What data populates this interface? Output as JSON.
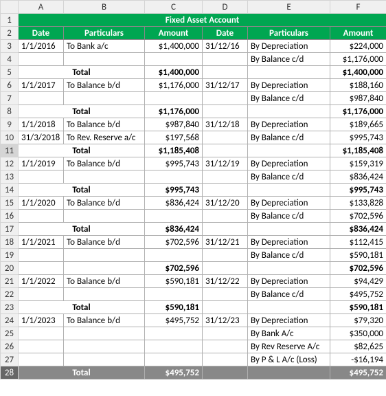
{
  "columns": [
    "A",
    "B",
    "C",
    "D",
    "E",
    "F"
  ],
  "title": "Fixed Asset Account",
  "headers": {
    "date1": "Date",
    "part1": "Particulars",
    "amt1": "Amount",
    "date2": "Date",
    "part2": "Particulars",
    "amt2": "Amount"
  },
  "r3": {
    "a": "1/1/2016",
    "b": "To Bank a/c",
    "c": "$1,400,000",
    "d": "31/12/16",
    "e": "By Depreciation",
    "f": "$224,000"
  },
  "r4": {
    "a": "",
    "b": "",
    "c": "",
    "d": "",
    "e": "By Balance c/d",
    "f": "$1,176,000"
  },
  "r5": {
    "tot": "Total",
    "c": "$1,400,000",
    "d": "",
    "e": "",
    "f": "$1,400,000"
  },
  "r6": {
    "a": "1/1/2017",
    "b": "To Balance b/d",
    "c": "$1,176,000",
    "d": "31/12/17",
    "e": "By Depreciation",
    "f": "$188,160"
  },
  "r7": {
    "a": "",
    "b": "",
    "c": "",
    "d": "",
    "e": "By Balance c/d",
    "f": "$987,840"
  },
  "r8": {
    "tot": "Total",
    "c": "$1,176,000",
    "d": "",
    "e": "",
    "f": "$1,176,000"
  },
  "r9": {
    "a": "1/1/2018",
    "b": "To Balance b/d",
    "c": "$987,840",
    "d": "31/12/18",
    "e": "By Depreciation",
    "f": "$189,665"
  },
  "r10": {
    "a": "31/3/2018",
    "b": "To Rev. Reserve a/c",
    "c": "$197,568",
    "d": "",
    "e": "By Balance c/d",
    "f": "$995,743"
  },
  "r11": {
    "tot": "Total",
    "c": "$1,185,408",
    "d": "",
    "e": "",
    "f": "$1,185,408"
  },
  "r12": {
    "a": "1/1/2019",
    "b": "To Balance b/d",
    "c": "$995,743",
    "d": "31/12/19",
    "e": "By Depreciation",
    "f": "$159,319"
  },
  "r13": {
    "a": "",
    "b": "",
    "c": "",
    "d": "",
    "e": "By Balance c/d",
    "f": "$836,424"
  },
  "r14": {
    "tot": "Total",
    "c": "$995,743",
    "d": "",
    "e": "",
    "f": "$995,743"
  },
  "r15": {
    "a": "1/1/2020",
    "b": "To Balance b/d",
    "c": "$836,424",
    "d": "31/12/20",
    "e": "By Depreciation",
    "f": "$133,828"
  },
  "r16": {
    "a": "",
    "b": "",
    "c": "",
    "d": "",
    "e": "By Balance c/d",
    "f": "$702,596"
  },
  "r17": {
    "tot": "Total",
    "c": "$836,424",
    "d": "",
    "e": "",
    "f": "$836,424"
  },
  "r18": {
    "a": "1/1/2021",
    "b": "To Balance b/d",
    "c": "$702,596",
    "d": "31/12/21",
    "e": "By Depreciation",
    "f": "$112,415"
  },
  "r19": {
    "a": "",
    "b": "",
    "c": "",
    "d": "",
    "e": "By Balance c/d",
    "f": "$590,181"
  },
  "r20": {
    "a": "",
    "b": "",
    "c": "$702,596",
    "d": "",
    "e": "",
    "f": "$702,596"
  },
  "r21": {
    "a": "1/1/2022",
    "b": "To Balance b/d",
    "c": "$590,181",
    "d": "31/12/22",
    "e": "By Depreciation",
    "f": "$94,429"
  },
  "r22": {
    "a": "",
    "b": "",
    "c": "",
    "d": "",
    "e": "By Balance c/d",
    "f": "$495,752"
  },
  "r23": {
    "tot": "Total",
    "c": "$590,181",
    "d": "",
    "e": "",
    "f": "$590,181"
  },
  "r24": {
    "a": "1/1/2023",
    "b": "To Balance b/d",
    "c": "$495,752",
    "d": "31/12/23",
    "e": "By Depreciation",
    "f": "$79,320"
  },
  "r25": {
    "a": "",
    "b": "",
    "c": "",
    "d": "",
    "e": "By Bank A/c",
    "f": "$350,000"
  },
  "r26": {
    "a": "",
    "b": "",
    "c": "",
    "d": "",
    "e": "By Rev Reserve A/c",
    "f": "$82,625"
  },
  "r27": {
    "a": "",
    "b": "",
    "c": "",
    "d": "",
    "e": "By P & L A/c  (Loss)",
    "f": "-$16,194"
  },
  "r28": {
    "tot": "Total",
    "c": "$495,752",
    "d": "",
    "e": "",
    "f": "$495,752"
  }
}
